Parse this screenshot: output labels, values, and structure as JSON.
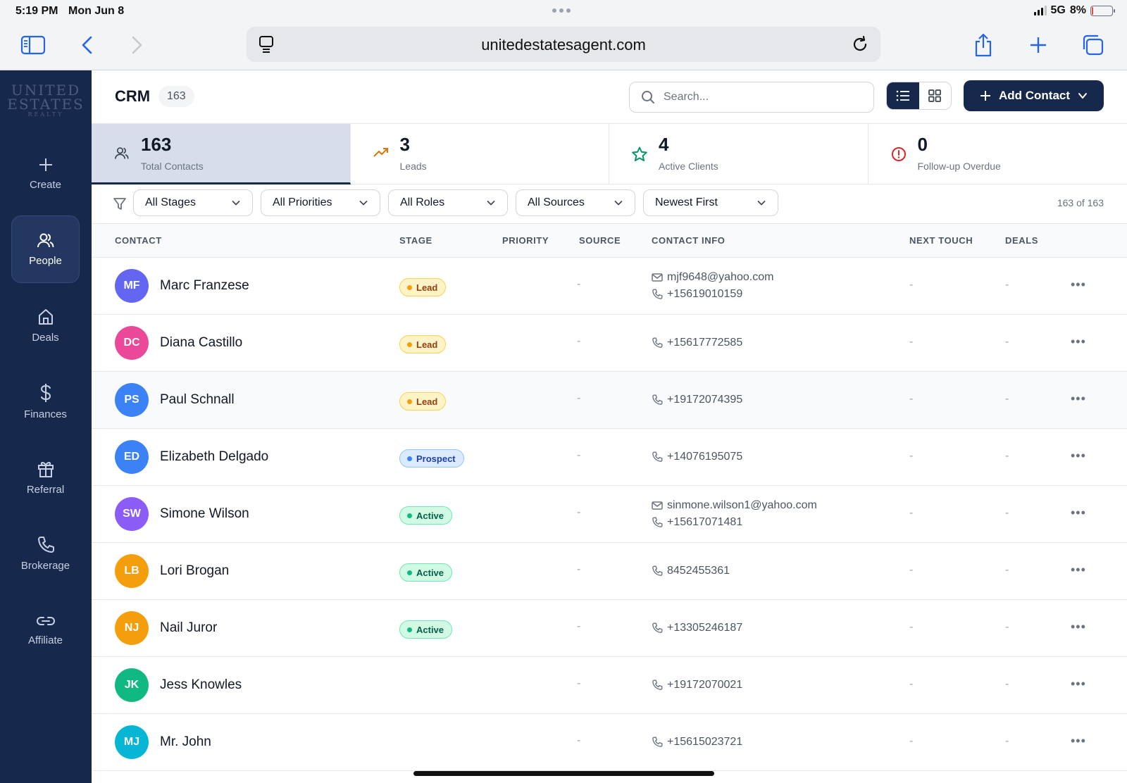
{
  "status_bar": {
    "time": "5:19 PM",
    "date": "Mon Jun 8",
    "network": "5G",
    "battery": "8%",
    "battery_level": 0.08
  },
  "browser": {
    "url": "unitedestatesagent.com"
  },
  "logo": {
    "line1": "UNITED",
    "line2": "ESTATES",
    "line3": "REALTY"
  },
  "sidebar": {
    "items": [
      {
        "label": "Create",
        "icon": "plus-icon",
        "active": false
      },
      {
        "label": "People",
        "icon": "people-icon",
        "active": true
      },
      {
        "label": "Deals",
        "icon": "home-icon",
        "active": false
      },
      {
        "label": "Finances",
        "icon": "dollar-icon",
        "active": false
      },
      {
        "label": "Referral",
        "icon": "gift-icon",
        "active": false
      },
      {
        "label": "Brokerage",
        "icon": "phone-icon",
        "active": false
      },
      {
        "label": "Affiliate",
        "icon": "link-icon",
        "active": false
      }
    ]
  },
  "header": {
    "title": "CRM",
    "count": "163",
    "search_placeholder": "Search...",
    "add_label": "Add Contact"
  },
  "stats": [
    {
      "value": "163",
      "label": "Total Contacts",
      "icon": "people-icon",
      "color": "#374151"
    },
    {
      "value": "3",
      "label": "Leads",
      "icon": "trending-up-icon",
      "color": "#d97706"
    },
    {
      "value": "4",
      "label": "Active Clients",
      "icon": "star-icon",
      "color": "#059669"
    },
    {
      "value": "0",
      "label": "Follow-up Overdue",
      "icon": "alert-circle-icon",
      "color": "#dc2626"
    }
  ],
  "filters": {
    "stages": "All Stages",
    "priorities": "All Priorities",
    "roles": "All Roles",
    "sources": "All Sources",
    "sort": "Newest First",
    "count_text": "163 of 163"
  },
  "columns": {
    "contact": "CONTACT",
    "stage": "STAGE",
    "priority": "PRIORITY",
    "source": "SOURCE",
    "contact_info": "CONTACT INFO",
    "next_touch": "NEXT TOUCH",
    "deals": "DEALS"
  },
  "contacts": [
    {
      "initials": "MF",
      "name": "Marc Franzese",
      "avatar_color": "#6366f1",
      "stage": "Lead",
      "source": "-",
      "email": "mjf9648@yahoo.com",
      "phone": "+15619010159",
      "next_touch": "-",
      "deals": "-"
    },
    {
      "initials": "DC",
      "name": "Diana Castillo",
      "avatar_color": "#ec4899",
      "stage": "Lead",
      "source": "-",
      "email": "",
      "phone": "+15617772585",
      "next_touch": "-",
      "deals": "-"
    },
    {
      "initials": "PS",
      "name": "Paul Schnall",
      "avatar_color": "#3b82f6",
      "stage": "Lead",
      "source": "-",
      "email": "",
      "phone": "+19172074395",
      "next_touch": "-",
      "deals": "-"
    },
    {
      "initials": "ED",
      "name": "Elizabeth Delgado",
      "avatar_color": "#3b82f6",
      "stage": "Prospect",
      "source": "-",
      "email": "",
      "phone": "+14076195075",
      "next_touch": "-",
      "deals": "-"
    },
    {
      "initials": "SW",
      "name": "Simone Wilson",
      "avatar_color": "#8b5cf6",
      "stage": "Active",
      "source": "-",
      "email": "sinmone.wilson1@yahoo.com",
      "phone": "+15617071481",
      "next_touch": "-",
      "deals": "-"
    },
    {
      "initials": "LB",
      "name": "Lori Brogan",
      "avatar_color": "#f59e0b",
      "stage": "Active",
      "source": "-",
      "email": "",
      "phone": "8452455361",
      "next_touch": "-",
      "deals": "-"
    },
    {
      "initials": "NJ",
      "name": "Nail Juror",
      "avatar_color": "#f59e0b",
      "stage": "Active",
      "source": "-",
      "email": "",
      "phone": "+13305246187",
      "next_touch": "-",
      "deals": "-"
    },
    {
      "initials": "JK",
      "name": "Jess Knowles",
      "avatar_color": "#10b981",
      "stage": "",
      "source": "-",
      "email": "",
      "phone": "+19172070021",
      "next_touch": "-",
      "deals": "-"
    },
    {
      "initials": "MJ",
      "name": "Mr. John",
      "avatar_color": "#06b6d4",
      "stage": "",
      "source": "-",
      "email": "",
      "phone": "+15615023721",
      "next_touch": "-",
      "deals": "-"
    }
  ],
  "stage_colors": {
    "Lead": {
      "bg": "#fef3c7",
      "border": "#fcd34d",
      "text": "#92400e",
      "dot": "#f59e0b"
    },
    "Prospect": {
      "bg": "#dbeafe",
      "border": "#93c5fd",
      "text": "#1e40af",
      "dot": "#3b82f6"
    },
    "Active": {
      "bg": "#d1fae5",
      "border": "#6ee7b7",
      "text": "#065f46",
      "dot": "#10b981"
    }
  },
  "accent_color": "#17284d"
}
